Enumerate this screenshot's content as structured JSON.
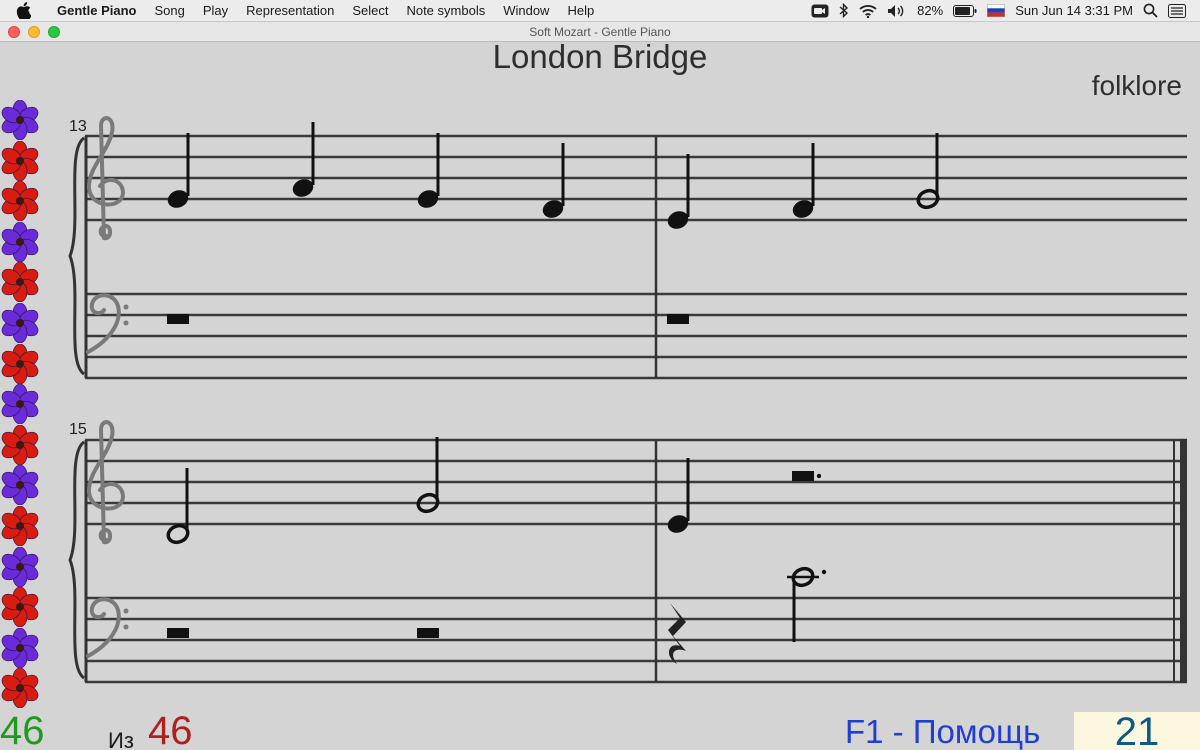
{
  "menubar": {
    "app_name": "Gentle Piano",
    "items": [
      "Song",
      "Play",
      "Representation",
      "Select",
      "Note symbols",
      "Window",
      "Help"
    ],
    "status": {
      "battery": "82%",
      "datetime": "Sun Jun 14  3:31 PM"
    }
  },
  "window": {
    "title": "Soft Mozart - Gentle Piano"
  },
  "song": {
    "title": "London Bridge",
    "composer": "folklore",
    "measures": [
      "13",
      "15"
    ]
  },
  "flowers": [
    "violet",
    "red",
    "red",
    "violet",
    "red",
    "violet",
    "red",
    "violet",
    "red",
    "violet",
    "red",
    "violet",
    "red",
    "violet",
    "red"
  ],
  "colors": {
    "violet": "#6a2bd9",
    "red": "#d81c10",
    "counter_current": "#1f9a1f",
    "counter_total": "#b01e1e",
    "help": "#1f3fd1"
  },
  "footer": {
    "current": "46",
    "of_label": "Из",
    "total": "46",
    "help": "F1 - Помощь",
    "score": "21"
  }
}
